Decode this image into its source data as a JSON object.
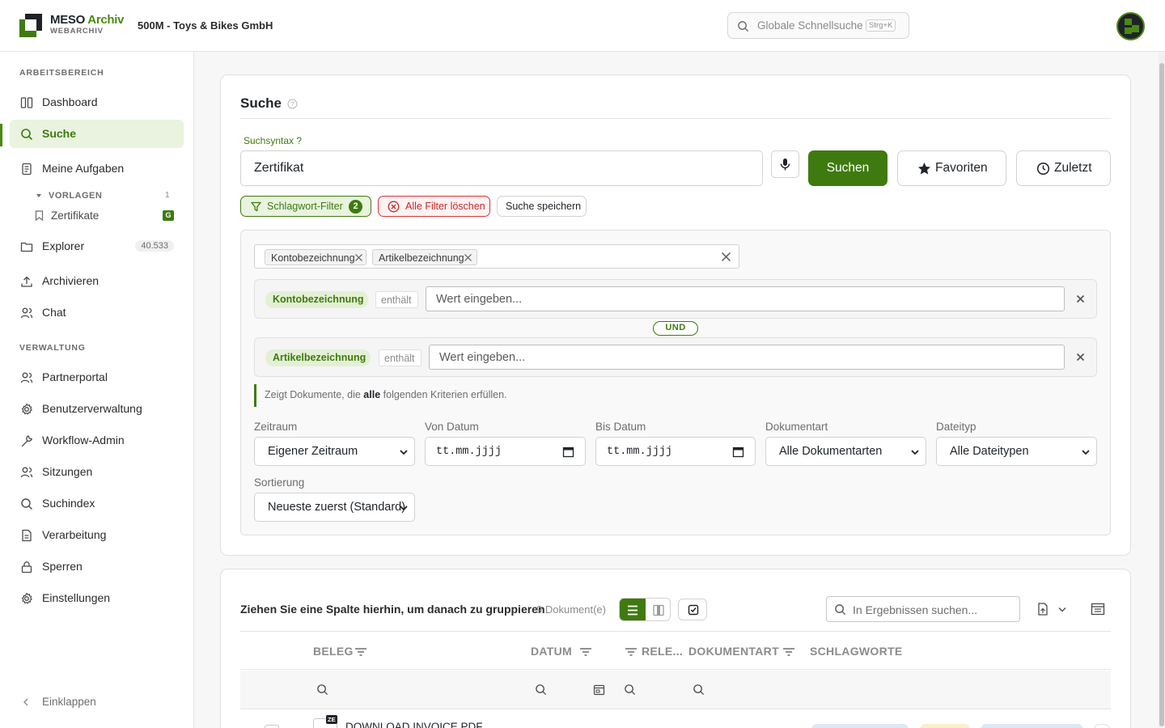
{
  "header": {
    "brand_main": "MESO",
    "brand_accent": "Archiv",
    "brand_sub": "WEBARCHIV",
    "company": "500M - Toys & Bikes GmbH",
    "search_placeholder": "Globale Schnellsuche",
    "search_shortcut": "Strg+K",
    "accent_color": "#3f7a10"
  },
  "sidebar": {
    "section_work": "ARBEITSBEREICH",
    "section_admin": "VERWALTUNG",
    "items": [
      {
        "label": "Dashboard",
        "icon": "dashboard-icon"
      },
      {
        "label": "Suche",
        "icon": "search-icon",
        "active": true
      },
      {
        "label": "Meine Aufgaben",
        "icon": "tasks-icon"
      },
      {
        "label": "Explorer",
        "icon": "folder-icon",
        "count": "40.533"
      },
      {
        "label": "Archivieren",
        "icon": "upload-icon"
      },
      {
        "label": "Chat",
        "icon": "chat-icon"
      }
    ],
    "templates": {
      "label": "VORLAGEN",
      "count": "1",
      "item": "Zertifikate",
      "badge": "G"
    },
    "admin_items": [
      {
        "label": "Partnerportal",
        "icon": "users-icon"
      },
      {
        "label": "Benutzerverwaltung",
        "icon": "gear-icon"
      },
      {
        "label": "Workflow-Admin",
        "icon": "wrench-icon"
      },
      {
        "label": "Sitzungen",
        "icon": "users-icon"
      },
      {
        "label": "Suchindex",
        "icon": "search-icon"
      },
      {
        "label": "Verarbeitung",
        "icon": "document-icon"
      },
      {
        "label": "Sperren",
        "icon": "lock-icon"
      },
      {
        "label": "Einstellungen",
        "icon": "gear-icon"
      }
    ],
    "collapse": "Einklappen"
  },
  "search": {
    "title": "Suche",
    "syntax_link": "Suchsyntax ?",
    "query": "Zertifikat",
    "search_button": "Suchen",
    "favorites_button": "Favoriten",
    "recent_button": "Zuletzt",
    "keyword_filter": "Schlagwort-Filter",
    "keyword_filter_count": "2",
    "clear_filters": "Alle Filter löschen",
    "save_search": "Suche speichern"
  },
  "filters": {
    "selected_tags": [
      "Kontobezeichnung",
      "Artikelbezeichnung"
    ],
    "conditions": [
      {
        "field": "Kontobezeichnung",
        "operator": "enthält",
        "placeholder": "Wert eingeben..."
      },
      {
        "field": "Artikelbezeichnung",
        "operator": "enthält",
        "placeholder": "Wert eingeben..."
      }
    ],
    "conjunction": "UND",
    "hint_before": "Zeigt Dokumente, die",
    "hint_bold": "alle",
    "hint_after": "folgenden Kriterien erfüllen.",
    "fields": {
      "zeitraum_label": "Zeitraum",
      "zeitraum_value": "Eigener Zeitraum",
      "von_label": "Von Datum",
      "von_value": "tt.mm.jjjj",
      "bis_label": "Bis Datum",
      "bis_value": "tt.mm.jjjj",
      "dokart_label": "Dokumentart",
      "dokart_value": "Alle Dokumentarten",
      "dateityp_label": "Dateityp",
      "dateityp_value": "Alle Dateitypen",
      "sort_label": "Sortierung",
      "sort_value": "Neueste zuerst (Standard)"
    }
  },
  "results": {
    "group_hint": "Ziehen Sie eine Spalte hierhin, um danach zu gruppieren",
    "count": "9 Dokument(e)",
    "search_placeholder": "In Ergebnissen suchen...",
    "columns": [
      "BELEG",
      "DATUM",
      "RELE...",
      "DOKUMENTART",
      "SCHLAGWORTE"
    ],
    "first_row_title": "DOWNLOAD INVOICE PDF",
    "first_row_badge": "ZE"
  }
}
